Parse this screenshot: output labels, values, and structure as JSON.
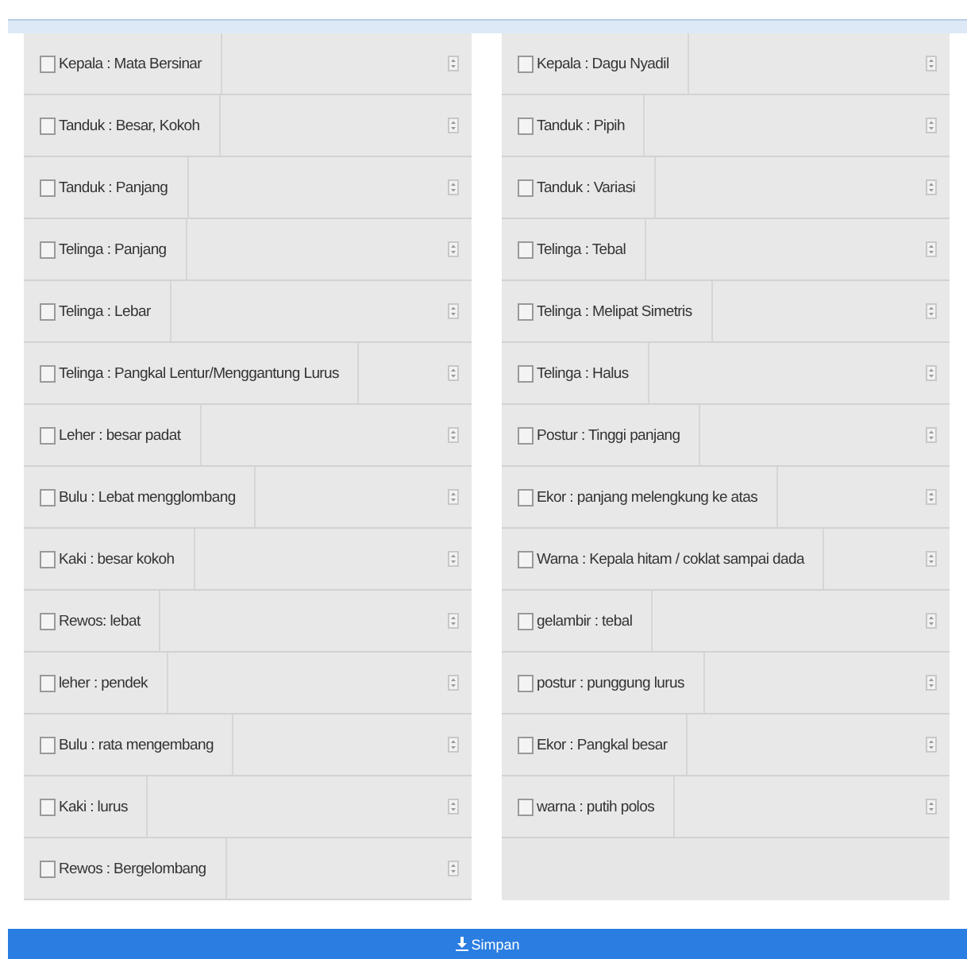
{
  "columns": [
    {
      "items": [
        {
          "label": "Kepala : Mata Bersinar",
          "checked": false
        },
        {
          "label": "Tanduk : Besar, Kokoh",
          "checked": false
        },
        {
          "label": "Tanduk : Panjang",
          "checked": false
        },
        {
          "label": "Telinga : Panjang",
          "checked": false
        },
        {
          "label": "Telinga : Lebar",
          "checked": false
        },
        {
          "label": "Telinga : Pangkal Lentur/Menggantung Lurus",
          "checked": false
        },
        {
          "label": "Leher : besar padat",
          "checked": false
        },
        {
          "label": "Bulu : Lebat mengglombang",
          "checked": false
        },
        {
          "label": "Kaki : besar kokoh",
          "checked": false
        },
        {
          "label": "Rewos: lebat",
          "checked": false
        },
        {
          "label": "leher : pendek",
          "checked": false
        },
        {
          "label": "Bulu : rata mengembang",
          "checked": false
        },
        {
          "label": "Kaki : lurus",
          "checked": false
        },
        {
          "label": "Rewos : Bergelombang",
          "checked": false
        }
      ]
    },
    {
      "items": [
        {
          "label": "Kepala : Dagu Nyadil",
          "checked": false
        },
        {
          "label": "Tanduk : Pipih",
          "checked": false
        },
        {
          "label": "Tanduk : Variasi",
          "checked": false
        },
        {
          "label": "Telinga : Tebal",
          "checked": false
        },
        {
          "label": "Telinga : Melipat Simetris",
          "checked": false
        },
        {
          "label": "Telinga : Halus",
          "checked": false
        },
        {
          "label": "Postur : Tinggi panjang",
          "checked": false
        },
        {
          "label": "Ekor : panjang melengkung ke atas",
          "checked": false
        },
        {
          "label": "Warna : Kepala hitam / coklat sampai dada",
          "checked": false
        },
        {
          "label": "gelambir : tebal",
          "checked": false
        },
        {
          "label": "postur : punggung lurus",
          "checked": false
        },
        {
          "label": "Ekor : Pangkal besar",
          "checked": false
        },
        {
          "label": "warna : putih polos",
          "checked": false
        }
      ]
    }
  ],
  "save_button": {
    "label": "Simpan"
  }
}
